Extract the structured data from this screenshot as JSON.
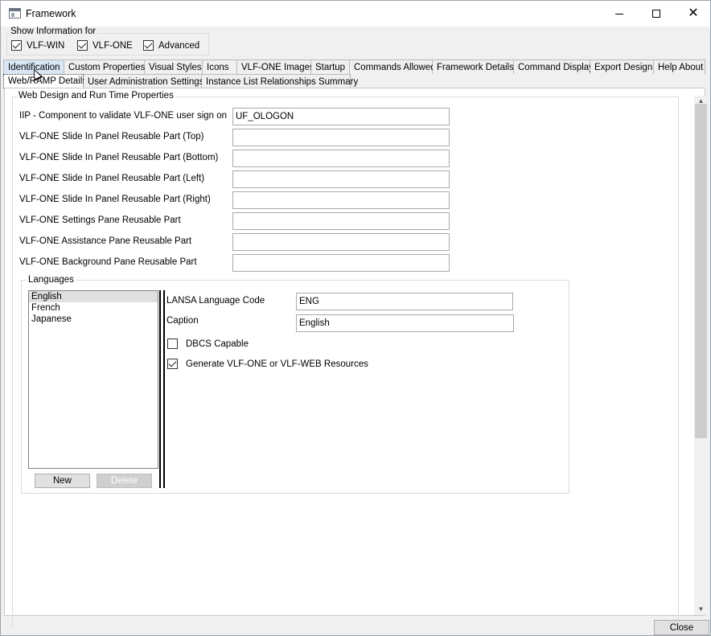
{
  "window": {
    "title": "Framework",
    "close_symbol": "✕"
  },
  "show_info": {
    "label": "Show Information for",
    "options": [
      {
        "label": "VLF-WIN",
        "checked": true
      },
      {
        "label": "VLF-ONE",
        "checked": true
      },
      {
        "label": "Advanced",
        "checked": true
      }
    ]
  },
  "tabs_primary": [
    "Identification",
    "Custom Properties",
    "Visual Styles",
    "Icons",
    "VLF-ONE Images",
    "Startup",
    "Commands Allowed",
    "Framework Details",
    "Command Display",
    "Export Design",
    "Help About"
  ],
  "tabs_secondary": [
    "Web/RAMP Details",
    "User Administration Settings",
    "Instance List Relationships Summary"
  ],
  "web_design": {
    "label": "Web Design and Run Time Properties",
    "rows": [
      {
        "label": "IIP - Component to validate VLF-ONE user sign on",
        "value": "UF_OLOGON"
      },
      {
        "label": "VLF-ONE Slide In Panel Reusable Part (Top)",
        "value": ""
      },
      {
        "label": "VLF-ONE Slide In Panel Reusable Part (Bottom)",
        "value": ""
      },
      {
        "label": "VLF-ONE Slide In Panel Reusable Part (Left)",
        "value": ""
      },
      {
        "label": "VLF-ONE Slide In Panel Reusable Part (Right)",
        "value": ""
      },
      {
        "label": "VLF-ONE Settings Pane Reusable Part",
        "value": ""
      },
      {
        "label": "VLF-ONE Assistance Pane Reusable Part",
        "value": ""
      },
      {
        "label": "VLF-ONE Background Pane Reusable Part",
        "value": ""
      }
    ]
  },
  "languages": {
    "label": "Languages",
    "items": [
      "English",
      "French",
      "Japanese"
    ],
    "selected": "English",
    "code_label": "LANSA Language Code",
    "code_value": "ENG",
    "caption_label": "Caption",
    "caption_value": "English",
    "dbcs_label": "DBCS Capable",
    "dbcs_checked": false,
    "generate_label": "Generate VLF-ONE or VLF-WEB Resources",
    "generate_checked": true,
    "new_label": "New",
    "delete_label": "Delete"
  },
  "footer": {
    "close_label": "Close"
  }
}
